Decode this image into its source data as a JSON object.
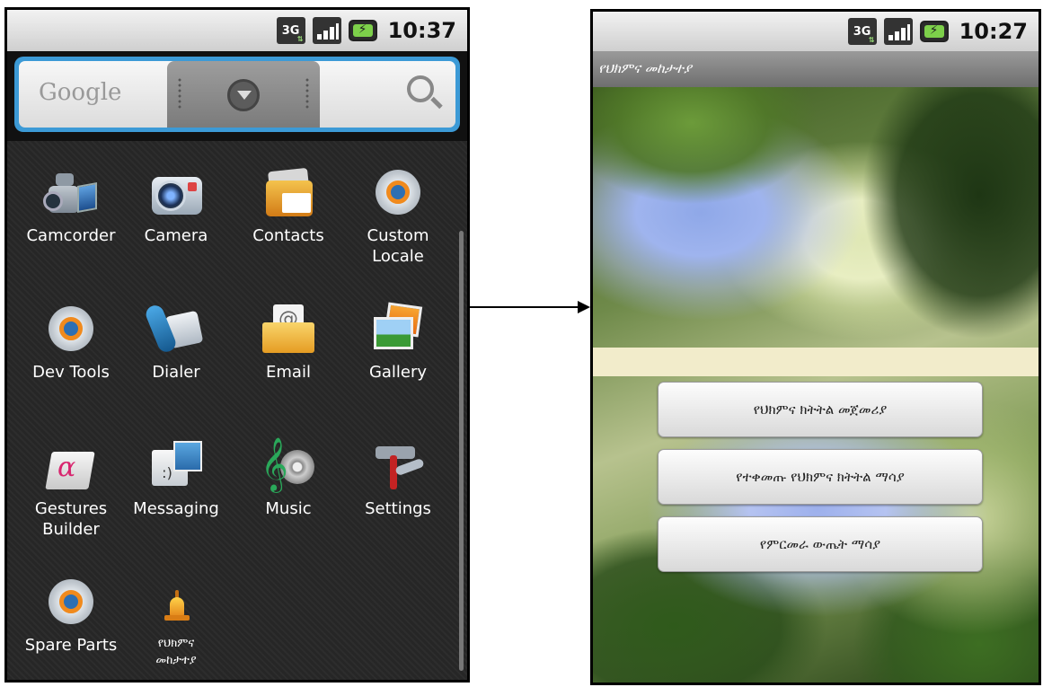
{
  "left_phone": {
    "status": {
      "network": "3G",
      "time": "10:37"
    },
    "search": {
      "brand": "Google"
    },
    "apps": [
      {
        "label": "Camcorder",
        "icon": "camcorder-icon"
      },
      {
        "label": "Camera",
        "icon": "camera-icon"
      },
      {
        "label": "Contacts",
        "icon": "contacts-icon"
      },
      {
        "label": "Custom\nLocale",
        "icon": "gear-icon"
      },
      {
        "label": "Dev Tools",
        "icon": "gear-icon"
      },
      {
        "label": "Dialer",
        "icon": "phone-icon"
      },
      {
        "label": "Email",
        "icon": "email-icon"
      },
      {
        "label": "Gallery",
        "icon": "gallery-icon"
      },
      {
        "label": "Gestures\nBuilder",
        "icon": "gestures-icon"
      },
      {
        "label": "Messaging",
        "icon": "messaging-icon"
      },
      {
        "label": "Music",
        "icon": "music-icon"
      },
      {
        "label": "Settings",
        "icon": "settings-icon"
      },
      {
        "label": "Spare Parts",
        "icon": "gear-icon"
      },
      {
        "label": "የህክምና\nመከታተያ",
        "icon": "bell-icon"
      }
    ]
  },
  "right_phone": {
    "status": {
      "network": "3G",
      "time": "10:27"
    },
    "title": "የህክምና መከታተያ",
    "buttons": [
      {
        "label": "የህክምና ክትትል መጀመሪያ"
      },
      {
        "label": "የተቀመጡ የህክምና ክትትል ማሳያ"
      },
      {
        "label": "የምርመራ ውጤት ማሳያ"
      }
    ]
  },
  "colors": {
    "search_frame": "#3c9ad6",
    "drawer_bg": "#262626",
    "band": "#f2eccb"
  }
}
